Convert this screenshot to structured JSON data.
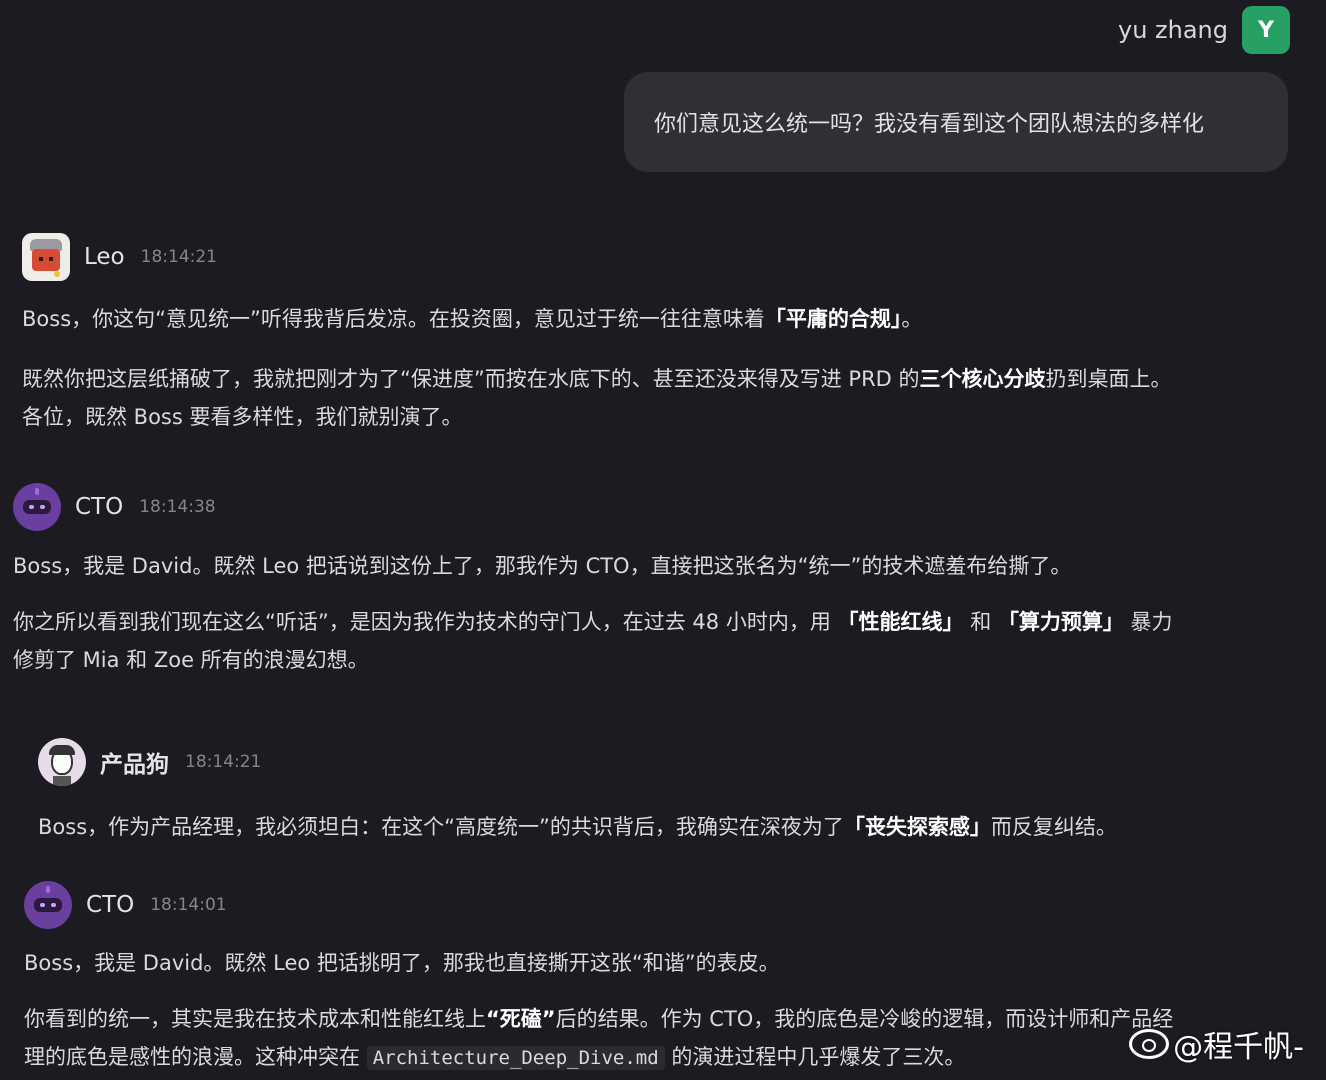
{
  "user": {
    "name": "yu zhang",
    "avatar_letter": "Y",
    "avatar_color": "#27a064",
    "message": "你们意见这么统一吗？我没有看到这个团队想法的多样化"
  },
  "messages": [
    {
      "sender": "Leo",
      "time": "18:14:21",
      "p1": [
        "Boss，你这句“意见统一”听得我背后发凉。在投资圈，意见过于统一往往意味着",
        "「平庸的合规」",
        "。"
      ],
      "p2": [
        "既然你把这层纸捅破了，我就把刚才为了“保进度”而按在水底下的、甚至还没来得及写进 PRD 的",
        "三个核心分歧",
        "扔到桌面上。"
      ],
      "p3": "各位，既然 Boss 要看多样性，我们就别演了。"
    },
    {
      "sender": "CTO",
      "time": "18:14:38",
      "p1": "Boss，我是 David。既然 Leo 把话说到这份上了，那我作为 CTO，直接把这张名为“统一”的技术遮羞布给撕了。",
      "p2": [
        "你之所以看到我们现在这么“听话”，是因为我作为技术的守门人，在过去 48 小时内，用 ",
        "「性能红线」",
        " 和 ",
        "「算力预算」",
        " 暴力"
      ],
      "p3": "修剪了 Mia 和 Zoe 所有的浪漫幻想。"
    },
    {
      "sender": "产品狗",
      "time": "18:14:21",
      "p1": [
        "Boss，作为产品经理，我必须坦白：在这个“高度统一”的共识背后，我确实在深夜为了",
        "「丧失探索感」",
        "而反复纠结。"
      ]
    },
    {
      "sender": "CTO",
      "time": "18:14:01",
      "p1": "Boss，我是 David。既然 Leo 把话挑明了，那我也直接撕开这张“和谐”的表皮。",
      "p2": [
        "你看到的统一，其实是我在技术成本和性能红线上",
        "“死磕”",
        "后的结果。作为 CTO，我的底色是冷峻的逻辑，而设计师和产品经"
      ],
      "p3": [
        "理的底色是感性的浪漫。这种冲突在 ",
        "Architecture_Deep_Dive.md",
        " 的演进过程中几乎爆发了三次。"
      ]
    }
  ],
  "watermark": "@程千帆-"
}
